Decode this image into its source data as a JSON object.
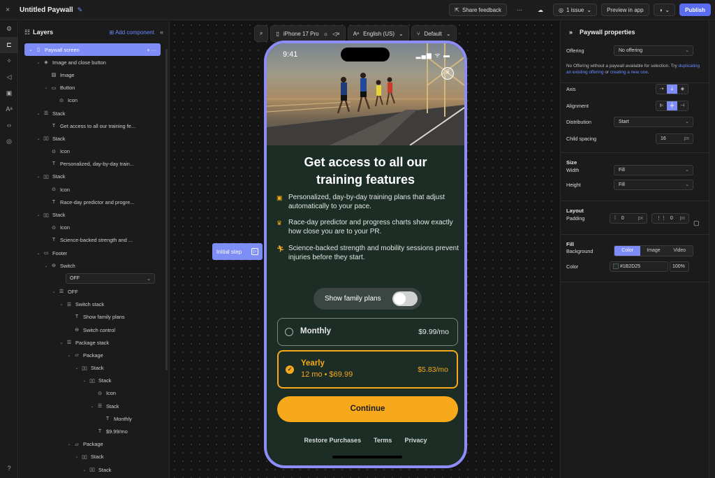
{
  "topbar": {
    "close": "×",
    "title": "Untitled Paywall",
    "edit_icon": "✎",
    "share": "Share feedback",
    "more": "···",
    "issues": "1 issue",
    "preview": "Preview in app",
    "publish": "Publish"
  },
  "rail": [
    "⚙",
    "⊏",
    "✧",
    "◁",
    "▣",
    "Aᵃ",
    "‹›",
    "◎"
  ],
  "layers": {
    "title": "Layers",
    "add": "Add component",
    "tree": [
      {
        "d": 0,
        "ch": "⌄",
        "ic": "▯",
        "label": "Paywall screen",
        "sel": true
      },
      {
        "d": 1,
        "ch": "⌄",
        "ic": "◈",
        "label": "Image and close button"
      },
      {
        "d": 2,
        "ch": "",
        "ic": "▨",
        "label": "Image"
      },
      {
        "d": 2,
        "ch": "⌄",
        "ic": "▭",
        "label": "Button"
      },
      {
        "d": 3,
        "ch": "",
        "ic": "⊙",
        "label": "Icon"
      },
      {
        "d": 1,
        "ch": "⌄",
        "ic": "☰",
        "label": "Stack"
      },
      {
        "d": 2,
        "ch": "",
        "ic": "T",
        "label": "Get access to all our training fe..."
      },
      {
        "d": 1,
        "ch": "⌄",
        "ic": "▯▯",
        "label": "Stack"
      },
      {
        "d": 2,
        "ch": "",
        "ic": "⊙",
        "label": "Icon"
      },
      {
        "d": 2,
        "ch": "",
        "ic": "T",
        "label": "Personalized, day-by-day train..."
      },
      {
        "d": 1,
        "ch": "⌄",
        "ic": "▯▯",
        "label": "Stack"
      },
      {
        "d": 2,
        "ch": "",
        "ic": "⊙",
        "label": "Icon"
      },
      {
        "d": 2,
        "ch": "",
        "ic": "T",
        "label": "Race-day predictor and progre..."
      },
      {
        "d": 1,
        "ch": "⌄",
        "ic": "▯▯",
        "label": "Stack"
      },
      {
        "d": 2,
        "ch": "",
        "ic": "⊙",
        "label": "Icon"
      },
      {
        "d": 2,
        "ch": "",
        "ic": "T",
        "label": "Science-backed strength and ..."
      },
      {
        "d": 1,
        "ch": "⌄",
        "ic": "▭",
        "label": "Footer"
      },
      {
        "d": 2,
        "ch": "⌄",
        "ic": "⊖",
        "label": "Switch"
      }
    ],
    "dropdown": "OFF",
    "tree2": [
      {
        "d": 3,
        "ch": "⌄",
        "ic": "☰",
        "label": "OFF"
      },
      {
        "d": 4,
        "ch": "⌄",
        "ic": "☰",
        "label": "Switch stack"
      },
      {
        "d": 5,
        "ch": "",
        "ic": "T",
        "label": "Show family plans"
      },
      {
        "d": 5,
        "ch": "",
        "ic": "⊖",
        "label": "Switch control"
      },
      {
        "d": 4,
        "ch": "⌄",
        "ic": "☰",
        "label": "Package stack"
      },
      {
        "d": 5,
        "ch": "⌄",
        "ic": "▱",
        "label": "Package"
      },
      {
        "d": 6,
        "ch": "⌄",
        "ic": "▯▯",
        "label": "Stack"
      },
      {
        "d": 7,
        "ch": "⌄",
        "ic": "▯▯",
        "label": "Stack"
      },
      {
        "d": 8,
        "ch": "",
        "ic": "⊙",
        "label": "Icon"
      },
      {
        "d": 8,
        "ch": "⌄",
        "ic": "☰",
        "label": "Stack"
      },
      {
        "d": 9,
        "ch": "",
        "ic": "T",
        "label": "Monthly"
      },
      {
        "d": 8,
        "ch": "",
        "ic": "T",
        "label": "$9.99/mo"
      },
      {
        "d": 5,
        "ch": "⌄",
        "ic": "▱",
        "label": "Package"
      },
      {
        "d": 6,
        "ch": "⌄",
        "ic": "▯▯",
        "label": "Stack"
      },
      {
        "d": 7,
        "ch": "⌄",
        "ic": "▯▯",
        "label": "Stack"
      }
    ]
  },
  "canvas": {
    "device": "iPhone 17 Pro",
    "language": "English (US)",
    "theme": "Default",
    "initial_step": "Initial step"
  },
  "paywall": {
    "time": "9:41",
    "status_icons": "▂▄▆ ᯤ ▬",
    "headline_1": "Get access to all our",
    "headline_2": "training features",
    "features": [
      {
        "icon": "▣",
        "text": "Personalized, day-by-day training plans that adjust automatically to your pace."
      },
      {
        "icon": "♛",
        "text": "Race-day predictor and progress charts show exactly how close you are to your PR."
      },
      {
        "icon": "🏃︎",
        "text": "Science-backed strength and mobility sessions prevent injuries before they start."
      }
    ],
    "toggle_label": "Show family plans",
    "monthly": {
      "name": "Monthly",
      "price": "$9.99/mo"
    },
    "yearly": {
      "name": "Yearly",
      "sub": "12 mo • $69.99",
      "price": "$5.83/mo"
    },
    "continue": "Continue",
    "footer": [
      "Restore Purchases",
      "Terms",
      "Privacy"
    ],
    "accent": "#f7a81b",
    "background": "#1b2d25"
  },
  "props": {
    "title": "Paywall properties",
    "offering_label": "Offering",
    "offering_value": "No offering",
    "note_1": "No Offering without a paywall available for selection. Try",
    "note_link1": "duplicating an existing offering",
    "note_or": "or",
    "note_link2": "creating a new one",
    "axis": "Axis",
    "alignment": "Alignment",
    "distribution": "Distribution",
    "distribution_value": "Start",
    "child_spacing": "Child spacing",
    "child_spacing_value": "16",
    "unit": "px",
    "size": "Size",
    "width": "Width",
    "width_value": "Fill",
    "height": "Height",
    "height_value": "Fill",
    "layout": "Layout",
    "padding": "Padding",
    "padding_v": "0",
    "padding_h": "0",
    "fill": "Fill",
    "background": "Background",
    "bg_tabs": [
      "Color",
      "Image",
      "Video"
    ],
    "color_label": "Color",
    "color_value": "#1B2D25",
    "opacity": "100%"
  }
}
